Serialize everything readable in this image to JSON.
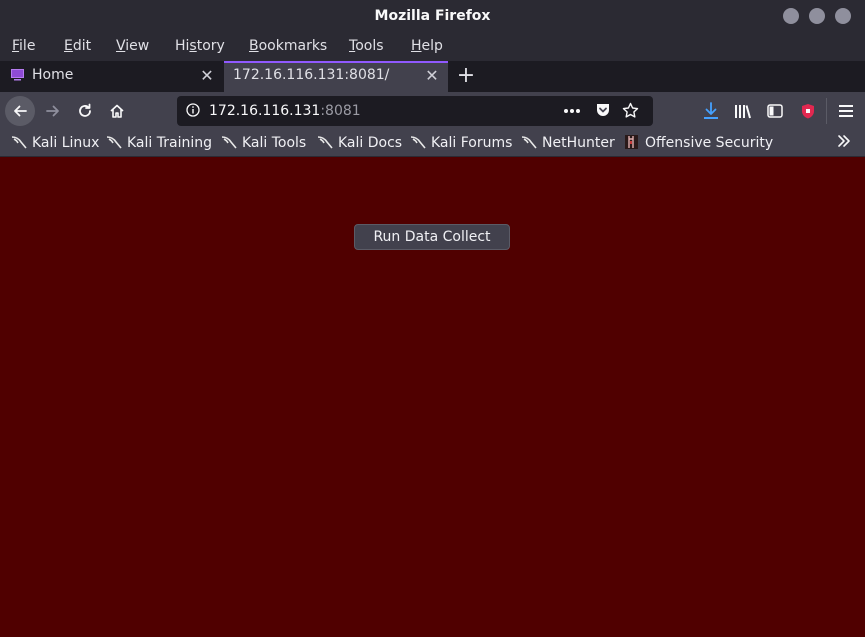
{
  "window": {
    "title": "Mozilla Firefox"
  },
  "menu": [
    {
      "pre": "",
      "u": "F",
      "post": "ile"
    },
    {
      "pre": "",
      "u": "E",
      "post": "dit"
    },
    {
      "pre": "",
      "u": "V",
      "post": "iew"
    },
    {
      "pre": "Hi",
      "u": "s",
      "post": "tory"
    },
    {
      "pre": "",
      "u": "B",
      "post": "ookmarks"
    },
    {
      "pre": "",
      "u": "T",
      "post": "ools"
    },
    {
      "pre": "",
      "u": "H",
      "post": "elp"
    }
  ],
  "tabs": {
    "home": {
      "label": "Home"
    },
    "active": {
      "label": "172.16.116.131:8081/"
    }
  },
  "urlbar": {
    "host": "172.16.116.131",
    "port": ":8081"
  },
  "bookmarks": [
    "Kali Linux",
    "Kali Training",
    "Kali Tools",
    "Kali Docs",
    "Kali Forums",
    "NetHunter",
    "Offensive Security"
  ],
  "page": {
    "button_label": "Run Data Collect"
  },
  "colors": {
    "page_background": "#500000",
    "accent": "#9059ff",
    "download_icon": "#45a1ff",
    "extension_badge": "#e22850"
  }
}
